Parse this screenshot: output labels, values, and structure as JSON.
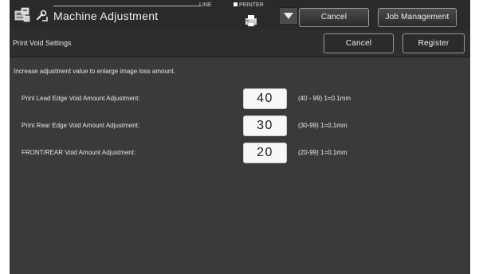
{
  "header": {
    "title": "Machine Adjustment",
    "line_label": "LINE",
    "printer_label": "PRINTER",
    "cancel_label": "Cancel",
    "job_management_label": "Job Management"
  },
  "screen": {
    "title": "Print Void Settings",
    "cancel_label": "Cancel",
    "register_label": "Register"
  },
  "instructions": "Increase adjustment value to enlarge image loss amount.",
  "settings": [
    {
      "label": "Print Lead Edge Void Amount Adjustment:",
      "value": "40",
      "range": "(40 - 99) 1=0.1mm"
    },
    {
      "label": "Print Rear Edge Void Amount Adjustment:",
      "value": "30",
      "range": "(30-99) 1=0.1mm"
    },
    {
      "label": "FRONT/REAR Void Amount Adjustment:",
      "value": "20",
      "range": "(20-99) 1=0.1mm"
    }
  ],
  "icons": {
    "app": "machine-adjustment-icon",
    "mode": "wrench-icon",
    "printer": "printer-icon",
    "dropdown": "triangle-down-icon"
  },
  "colors": {
    "background": "#3a3a3a",
    "header": "#2a2a2a",
    "value_box": "#f7f7f7"
  }
}
